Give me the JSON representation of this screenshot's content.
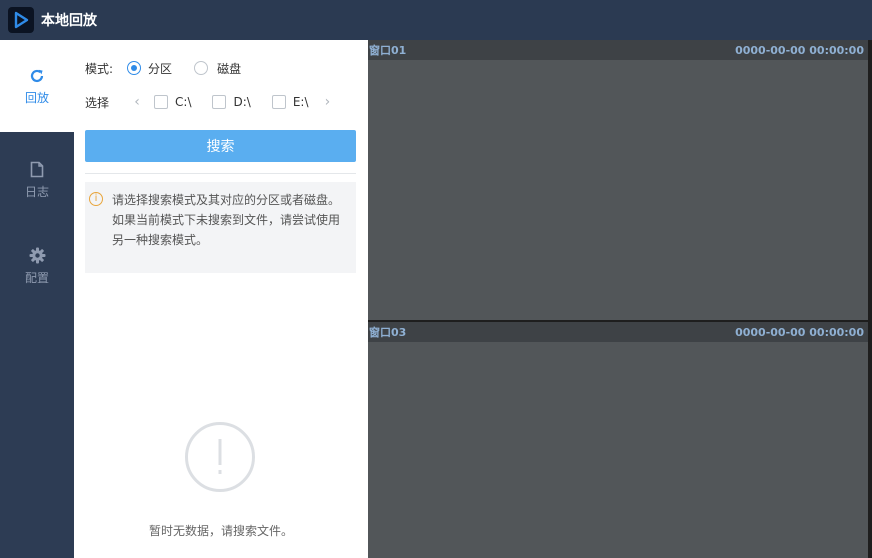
{
  "app": {
    "title": "本地回放"
  },
  "sidenav": {
    "items": [
      {
        "label": "回放",
        "icon": "refresh-icon",
        "active": true
      },
      {
        "label": "日志",
        "icon": "document-icon",
        "active": false
      },
      {
        "label": "配置",
        "icon": "gear-icon",
        "active": false
      }
    ]
  },
  "panel": {
    "mode_label": "模式:",
    "mode_options": [
      {
        "label": "分区",
        "selected": true
      },
      {
        "label": "磁盘",
        "selected": false
      }
    ],
    "select_label": "选择",
    "drives": [
      {
        "label": "C:\\",
        "checked": false
      },
      {
        "label": "D:\\",
        "checked": false
      },
      {
        "label": "E:\\",
        "checked": false
      }
    ],
    "search_button": "搜索",
    "notice": "请选择搜索模式及其对应的分区或者磁盘。如果当前模式下未搜索到文件，请尝试使用另一种搜索模式。",
    "empty_text": "暂时无数据，请搜索文件。"
  },
  "windows": [
    {
      "name": "窗口01",
      "time": "0000-00-00 00:00:00"
    },
    {
      "name": "窗口03",
      "time": "0000-00-00 00:00:00"
    }
  ],
  "colors": {
    "accent": "#2f8be8",
    "button": "#5aaef0",
    "sidebar": "#2d3c54",
    "warning": "#e8a53c"
  }
}
